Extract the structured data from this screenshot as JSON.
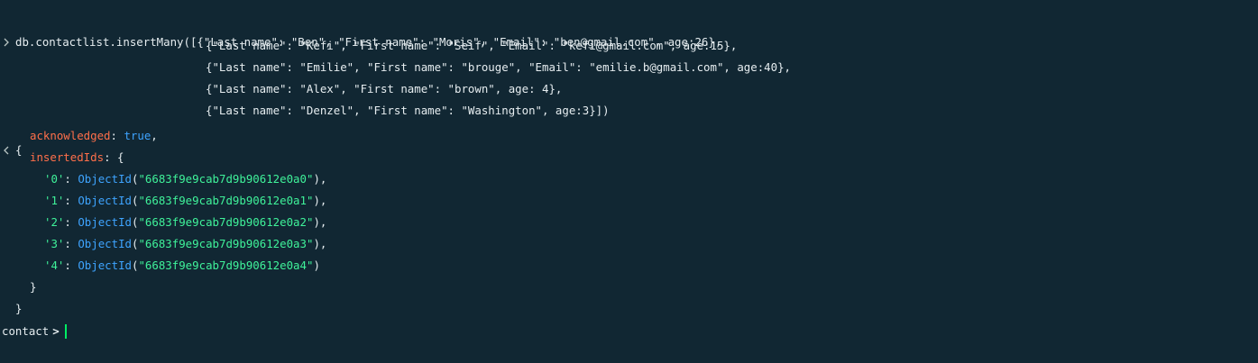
{
  "command": {
    "lines": [
      "db.contactlist.insertMany([{\"Last name\": \"Ben\", \"First name\": \"Moris\", \"Email\": \"ben@gmail.com\", age:26},",
      "{\"Last name\": \"Kefi\", \"First name\": \"Seif\", \"Email\": \"kefi@gmail.com\", age:15},",
      "{\"Last name\": \"Emilie\", \"First name\": \"brouge\", \"Email\": \"emilie.b@gmail.com\", age:40},",
      "{\"Last name\": \"Alex\", \"First name\": \"brown\", age: 4},",
      "{\"Last name\": \"Denzel\", \"First name\": \"Washington\", age:3}])"
    ]
  },
  "result": {
    "open_brace": "{",
    "acknowledged_key": "acknowledged",
    "acknowledged_value": "true",
    "inserted_key": "insertedIds",
    "inserted_open": "{",
    "ids": [
      {
        "index": "'0'",
        "fn": "ObjectId",
        "value": "\"6683f9e9cab7d9b90612e0a0\"",
        "trail": "),"
      },
      {
        "index": "'1'",
        "fn": "ObjectId",
        "value": "\"6683f9e9cab7d9b90612e0a1\"",
        "trail": "),"
      },
      {
        "index": "'2'",
        "fn": "ObjectId",
        "value": "\"6683f9e9cab7d9b90612e0a2\"",
        "trail": "),"
      },
      {
        "index": "'3'",
        "fn": "ObjectId",
        "value": "\"6683f9e9cab7d9b90612e0a3\"",
        "trail": "),"
      },
      {
        "index": "'4'",
        "fn": "ObjectId",
        "value": "\"6683f9e9cab7d9b90612e0a4\"",
        "trail": ")"
      }
    ],
    "inner_close": "}",
    "outer_close": "}"
  },
  "prompt": {
    "database": "contact",
    "symbol": ">"
  },
  "icons": {
    "input_marker": "chevron-right-icon",
    "output_marker": "chevron-left-icon"
  },
  "colors": {
    "background": "#112733",
    "key": "#ff6f4a",
    "string": "#3ff29a",
    "function": "#3ea4ff",
    "cursor": "#00ed64"
  }
}
